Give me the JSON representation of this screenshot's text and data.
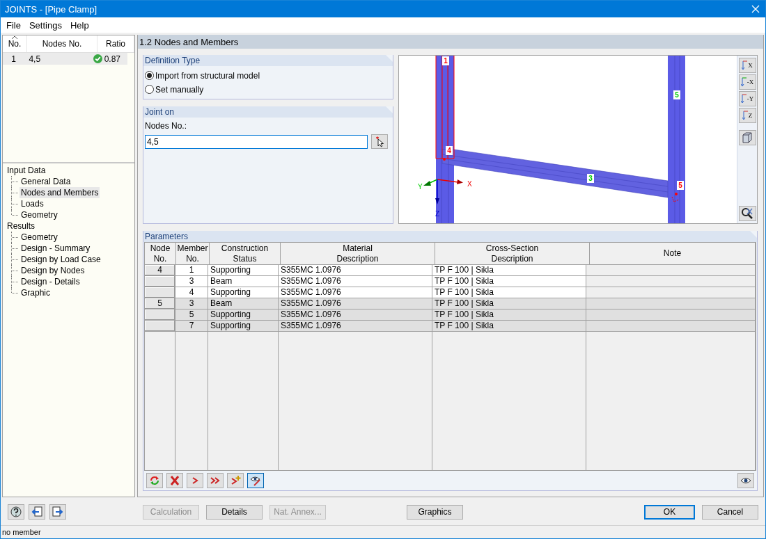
{
  "window": {
    "title": "JOINTS - [Pipe Clamp]"
  },
  "menu": [
    "File",
    "Settings",
    "Help"
  ],
  "joint_list": {
    "columns": [
      "No.",
      "Nodes No.",
      "Ratio"
    ],
    "rows": [
      {
        "no": "1",
        "nodes": "4,5",
        "ratio": "0.87",
        "ok": true,
        "selected": true
      }
    ]
  },
  "navigator": [
    {
      "label": "Input Data",
      "selected": false,
      "children": [
        {
          "label": "General Data",
          "selected": false
        },
        {
          "label": "Nodes and Members",
          "selected": true
        },
        {
          "label": "Loads",
          "selected": false
        },
        {
          "label": "Geometry",
          "selected": false
        }
      ]
    },
    {
      "label": "Results",
      "selected": false,
      "children": [
        {
          "label": "Geometry",
          "selected": false
        },
        {
          "label": "Design - Summary",
          "selected": false
        },
        {
          "label": "Design by Load Case",
          "selected": false
        },
        {
          "label": "Design by Nodes",
          "selected": false
        },
        {
          "label": "Design - Details",
          "selected": false
        },
        {
          "label": "Graphic",
          "selected": false
        }
      ]
    }
  ],
  "page_header": "1.2 Nodes and Members",
  "definition_type": {
    "title": "Definition Type",
    "options": [
      {
        "label": "Import from structural model",
        "selected": true
      },
      {
        "label": "Set manually",
        "selected": false
      }
    ]
  },
  "joint_on": {
    "title": "Joint on",
    "field_label": "Nodes No.:",
    "value": "4,5"
  },
  "model_view": {
    "labels": [
      {
        "text": "1",
        "color": "#ff0000"
      },
      {
        "text": "4",
        "color": "#ff0000"
      },
      {
        "text": "3",
        "color": "#00cc00"
      },
      {
        "text": "5",
        "color": "#00cc00"
      },
      {
        "text": "5",
        "color": "#ff0000"
      }
    ],
    "axes": [
      "X",
      "Y",
      "Z"
    ],
    "view_buttons": [
      "X",
      "-X",
      "-Y",
      "Z"
    ]
  },
  "parameters": {
    "title": "Parameters",
    "columns": [
      {
        "lines": [
          "Node",
          "No."
        ]
      },
      {
        "lines": [
          "Member",
          "No."
        ]
      },
      {
        "lines": [
          "Construction",
          "Status"
        ]
      },
      {
        "lines": [
          "Material",
          "Description"
        ]
      },
      {
        "lines": [
          "Cross-Section",
          "Description"
        ]
      },
      {
        "lines": [
          "Note"
        ]
      }
    ],
    "rows": [
      {
        "node": "4",
        "member": "1",
        "status": "Supporting",
        "material": "S355MC 1.0976",
        "section": "TP F 100 | Sikla",
        "shaded": false
      },
      {
        "node": "",
        "member": "3",
        "status": "Beam",
        "material": "S355MC 1.0976",
        "section": "TP F 100 | Sikla",
        "shaded": false
      },
      {
        "node": "",
        "member": "4",
        "status": "Supporting",
        "material": "S355MC 1.0976",
        "section": "TP F 100 | Sikla",
        "shaded": false
      },
      {
        "node": "5",
        "member": "3",
        "status": "Beam",
        "material": "S355MC 1.0976",
        "section": "TP F 100 | Sikla",
        "shaded": true
      },
      {
        "node": "",
        "member": "5",
        "status": "Supporting",
        "material": "S355MC 1.0976",
        "section": "TP F 100 | Sikla",
        "shaded": true
      },
      {
        "node": "",
        "member": "7",
        "status": "Supporting",
        "material": "S355MC 1.0976",
        "section": "TP F 100 | Sikla",
        "shaded": true
      }
    ],
    "tools": [
      {
        "kind": "refresh",
        "on": false
      },
      {
        "kind": "delete",
        "on": false
      },
      {
        "kind": "next",
        "on": false
      },
      {
        "kind": "last",
        "on": false
      },
      {
        "kind": "add",
        "on": false
      },
      {
        "kind": "edit-view",
        "on": true
      }
    ]
  },
  "buttons": [
    {
      "label": "Calculation",
      "disabled": true
    },
    {
      "label": "Details",
      "disabled": false
    },
    {
      "label": "Nat. Annex...",
      "disabled": true
    },
    {
      "label": "Graphics",
      "disabled": false
    },
    {
      "label": "OK",
      "disabled": false
    },
    {
      "label": "Cancel",
      "disabled": false
    }
  ],
  "status_bar": "no member"
}
